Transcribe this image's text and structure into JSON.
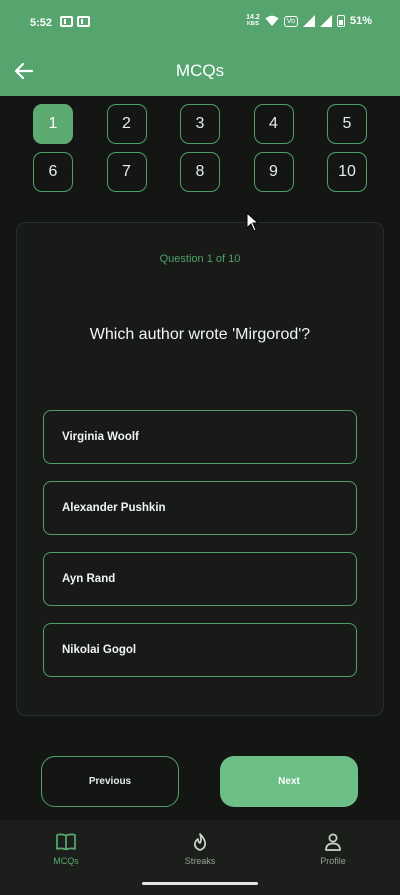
{
  "status": {
    "time": "5:52",
    "net_speed_top": "14.2",
    "net_speed_bottom": "KB/S",
    "volte": "Vo",
    "battery": "51%"
  },
  "appbar": {
    "title": "MCQs"
  },
  "question_numbers": [
    "1",
    "2",
    "3",
    "4",
    "5",
    "6",
    "7",
    "8",
    "9",
    "10"
  ],
  "active_question": "1",
  "quiz": {
    "progress": "Question 1 of 10",
    "question": "Which author wrote 'Mirgorod'?",
    "options": [
      "Virginia Woolf",
      "Alexander Pushkin",
      "Ayn Rand",
      "Nikolai Gogol"
    ]
  },
  "buttons": {
    "previous": "Previous",
    "next": "Next"
  },
  "bottom_nav": {
    "items": [
      {
        "label": "MCQs",
        "icon": "book-icon",
        "active": true
      },
      {
        "label": "Streaks",
        "icon": "flame-icon",
        "active": false
      },
      {
        "label": "Profile",
        "icon": "person-icon",
        "active": false
      }
    ]
  },
  "colors": {
    "accent": "#56a56e",
    "next_button": "#6cbf87",
    "background": "#141614"
  }
}
